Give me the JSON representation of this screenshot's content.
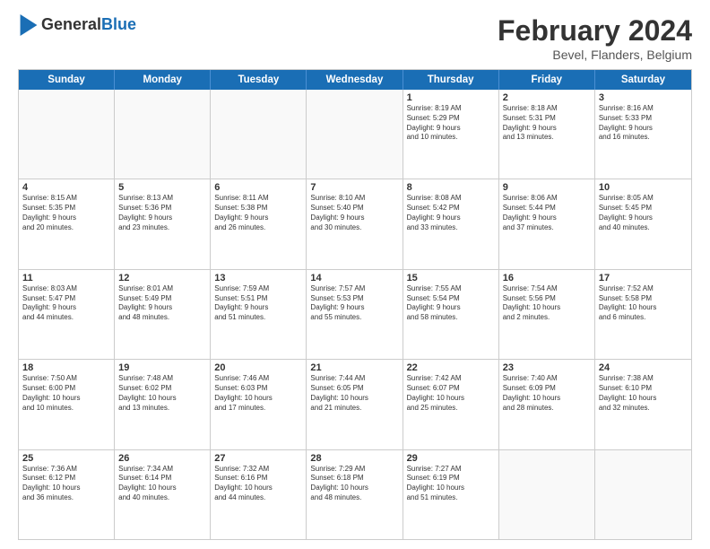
{
  "header": {
    "logo_general": "General",
    "logo_blue": "Blue",
    "month_year": "February 2024",
    "location": "Bevel, Flanders, Belgium"
  },
  "weekdays": [
    "Sunday",
    "Monday",
    "Tuesday",
    "Wednesday",
    "Thursday",
    "Friday",
    "Saturday"
  ],
  "rows": [
    [
      {
        "day": "",
        "text": ""
      },
      {
        "day": "",
        "text": ""
      },
      {
        "day": "",
        "text": ""
      },
      {
        "day": "",
        "text": ""
      },
      {
        "day": "1",
        "text": "Sunrise: 8:19 AM\nSunset: 5:29 PM\nDaylight: 9 hours\nand 10 minutes."
      },
      {
        "day": "2",
        "text": "Sunrise: 8:18 AM\nSunset: 5:31 PM\nDaylight: 9 hours\nand 13 minutes."
      },
      {
        "day": "3",
        "text": "Sunrise: 8:16 AM\nSunset: 5:33 PM\nDaylight: 9 hours\nand 16 minutes."
      }
    ],
    [
      {
        "day": "4",
        "text": "Sunrise: 8:15 AM\nSunset: 5:35 PM\nDaylight: 9 hours\nand 20 minutes."
      },
      {
        "day": "5",
        "text": "Sunrise: 8:13 AM\nSunset: 5:36 PM\nDaylight: 9 hours\nand 23 minutes."
      },
      {
        "day": "6",
        "text": "Sunrise: 8:11 AM\nSunset: 5:38 PM\nDaylight: 9 hours\nand 26 minutes."
      },
      {
        "day": "7",
        "text": "Sunrise: 8:10 AM\nSunset: 5:40 PM\nDaylight: 9 hours\nand 30 minutes."
      },
      {
        "day": "8",
        "text": "Sunrise: 8:08 AM\nSunset: 5:42 PM\nDaylight: 9 hours\nand 33 minutes."
      },
      {
        "day": "9",
        "text": "Sunrise: 8:06 AM\nSunset: 5:44 PM\nDaylight: 9 hours\nand 37 minutes."
      },
      {
        "day": "10",
        "text": "Sunrise: 8:05 AM\nSunset: 5:45 PM\nDaylight: 9 hours\nand 40 minutes."
      }
    ],
    [
      {
        "day": "11",
        "text": "Sunrise: 8:03 AM\nSunset: 5:47 PM\nDaylight: 9 hours\nand 44 minutes."
      },
      {
        "day": "12",
        "text": "Sunrise: 8:01 AM\nSunset: 5:49 PM\nDaylight: 9 hours\nand 48 minutes."
      },
      {
        "day": "13",
        "text": "Sunrise: 7:59 AM\nSunset: 5:51 PM\nDaylight: 9 hours\nand 51 minutes."
      },
      {
        "day": "14",
        "text": "Sunrise: 7:57 AM\nSunset: 5:53 PM\nDaylight: 9 hours\nand 55 minutes."
      },
      {
        "day": "15",
        "text": "Sunrise: 7:55 AM\nSunset: 5:54 PM\nDaylight: 9 hours\nand 58 minutes."
      },
      {
        "day": "16",
        "text": "Sunrise: 7:54 AM\nSunset: 5:56 PM\nDaylight: 10 hours\nand 2 minutes."
      },
      {
        "day": "17",
        "text": "Sunrise: 7:52 AM\nSunset: 5:58 PM\nDaylight: 10 hours\nand 6 minutes."
      }
    ],
    [
      {
        "day": "18",
        "text": "Sunrise: 7:50 AM\nSunset: 6:00 PM\nDaylight: 10 hours\nand 10 minutes."
      },
      {
        "day": "19",
        "text": "Sunrise: 7:48 AM\nSunset: 6:02 PM\nDaylight: 10 hours\nand 13 minutes."
      },
      {
        "day": "20",
        "text": "Sunrise: 7:46 AM\nSunset: 6:03 PM\nDaylight: 10 hours\nand 17 minutes."
      },
      {
        "day": "21",
        "text": "Sunrise: 7:44 AM\nSunset: 6:05 PM\nDaylight: 10 hours\nand 21 minutes."
      },
      {
        "day": "22",
        "text": "Sunrise: 7:42 AM\nSunset: 6:07 PM\nDaylight: 10 hours\nand 25 minutes."
      },
      {
        "day": "23",
        "text": "Sunrise: 7:40 AM\nSunset: 6:09 PM\nDaylight: 10 hours\nand 28 minutes."
      },
      {
        "day": "24",
        "text": "Sunrise: 7:38 AM\nSunset: 6:10 PM\nDaylight: 10 hours\nand 32 minutes."
      }
    ],
    [
      {
        "day": "25",
        "text": "Sunrise: 7:36 AM\nSunset: 6:12 PM\nDaylight: 10 hours\nand 36 minutes."
      },
      {
        "day": "26",
        "text": "Sunrise: 7:34 AM\nSunset: 6:14 PM\nDaylight: 10 hours\nand 40 minutes."
      },
      {
        "day": "27",
        "text": "Sunrise: 7:32 AM\nSunset: 6:16 PM\nDaylight: 10 hours\nand 44 minutes."
      },
      {
        "day": "28",
        "text": "Sunrise: 7:29 AM\nSunset: 6:18 PM\nDaylight: 10 hours\nand 48 minutes."
      },
      {
        "day": "29",
        "text": "Sunrise: 7:27 AM\nSunset: 6:19 PM\nDaylight: 10 hours\nand 51 minutes."
      },
      {
        "day": "",
        "text": ""
      },
      {
        "day": "",
        "text": ""
      }
    ]
  ]
}
